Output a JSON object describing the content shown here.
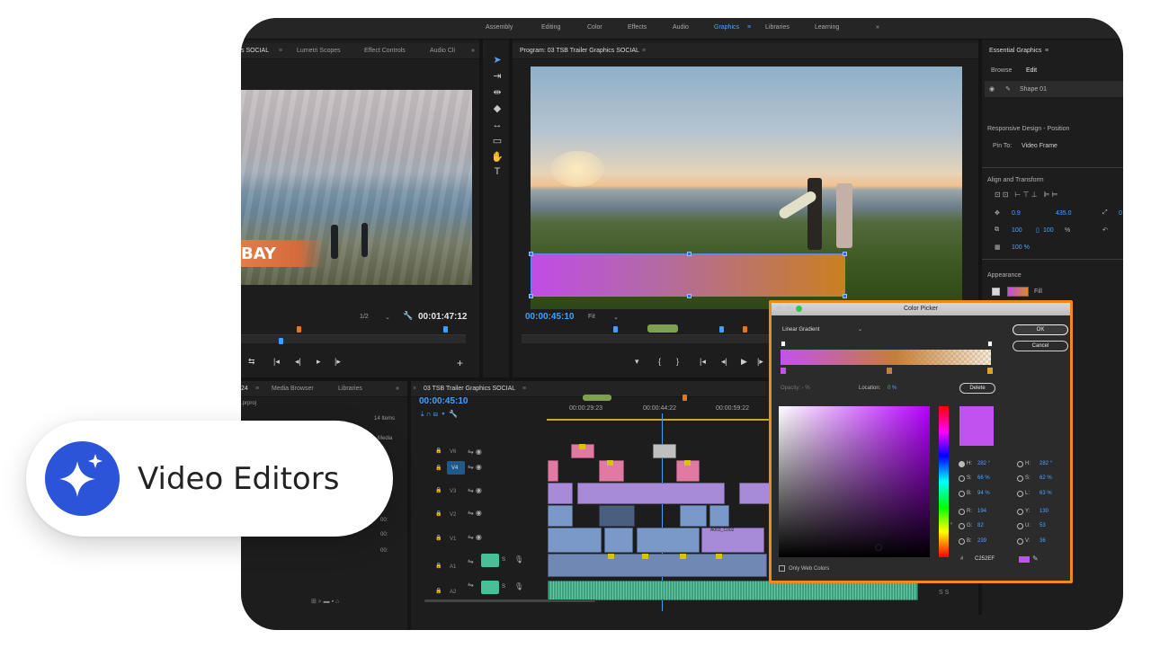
{
  "workspaces": {
    "tabs": [
      "Assembly",
      "Editing",
      "Color",
      "Effects",
      "Audio",
      "Graphics",
      "Libraries",
      "Learning"
    ],
    "active": "Graphics",
    "more": "»"
  },
  "source_panel": {
    "tabs": [
      "s SOCIAL",
      "Lumetri Scopes",
      "Effect Controls",
      "Audio Cli"
    ],
    "more": "»",
    "overlay_text": "BAY",
    "scale": "1/2",
    "timecode": "00:01:47:12"
  },
  "program_panel": {
    "title": "Program: 03 TSB Trailer Graphics SOCIAL",
    "timecode": "00:00:45:10",
    "fit": "Fit"
  },
  "essential_graphics": {
    "title": "Essential Graphics",
    "tabs": [
      "Browse",
      "Edit"
    ],
    "layer": "Shape 01",
    "responsive_title": "Responsive Design - Position",
    "pin_to_label": "Pin To:",
    "pin_to_value": "Video Frame",
    "align_title": "Align and Transform",
    "pos_x": "0.9",
    "pos_y": "435.0",
    "rotation": "0",
    "scale": "100",
    "scale_unit": "%",
    "opacity": "100 %",
    "appearance_title": "Appearance",
    "fill_label": "Fill"
  },
  "project_panel": {
    "tabs": [
      "24",
      "Media Browser",
      "Libraries"
    ],
    "more": "»",
    "file": ".prproj",
    "items": "14 Items",
    "media_label": "Media",
    "rows": [
      "00:",
      "00:",
      "00:"
    ]
  },
  "timeline": {
    "title": "03 TSB Trailer Graphics SOCIAL",
    "timecode": "00:00:45:10",
    "ruler": [
      "00:00:29:23",
      "00:00:44:22",
      "00:00:59:22"
    ],
    "tracks": [
      "V6",
      "V4",
      "V3",
      "V2",
      "V1",
      "A1",
      "A2"
    ],
    "clip_label": "A003_C002"
  },
  "color_picker": {
    "title": "Color Picker",
    "mode": "Linear Gradient",
    "ok": "OK",
    "cancel": "Cancel",
    "opacity_label": "Opacity: - %",
    "location_label": "Location:",
    "location_value": "0 %",
    "delete": "Delete",
    "only_web": "Only Web Colors",
    "hex_label": "#",
    "hex": "C252EF",
    "swatch_color": "#c252ef",
    "fields_left": [
      {
        "label": "H:",
        "value": "282 °"
      },
      {
        "label": "S:",
        "value": "66 %"
      },
      {
        "label": "B:",
        "value": "94 %"
      },
      {
        "label": "R:",
        "value": "194"
      },
      {
        "label": "G:",
        "value": "82"
      },
      {
        "label": "B:",
        "value": "239"
      }
    ],
    "fields_right": [
      {
        "label": "H:",
        "value": "282 °"
      },
      {
        "label": "S:",
        "value": "62 %"
      },
      {
        "label": "L:",
        "value": "63 %"
      },
      {
        "label": "Y:",
        "value": "130"
      },
      {
        "label": "U:",
        "value": "53"
      },
      {
        "label": "V:",
        "value": "36"
      }
    ]
  },
  "badge": {
    "text": "Video Editors",
    "accent": "#2b54d9"
  },
  "colors": {
    "picker_border": "#ee8b18",
    "highlight_blue": "#3ea0ff"
  }
}
